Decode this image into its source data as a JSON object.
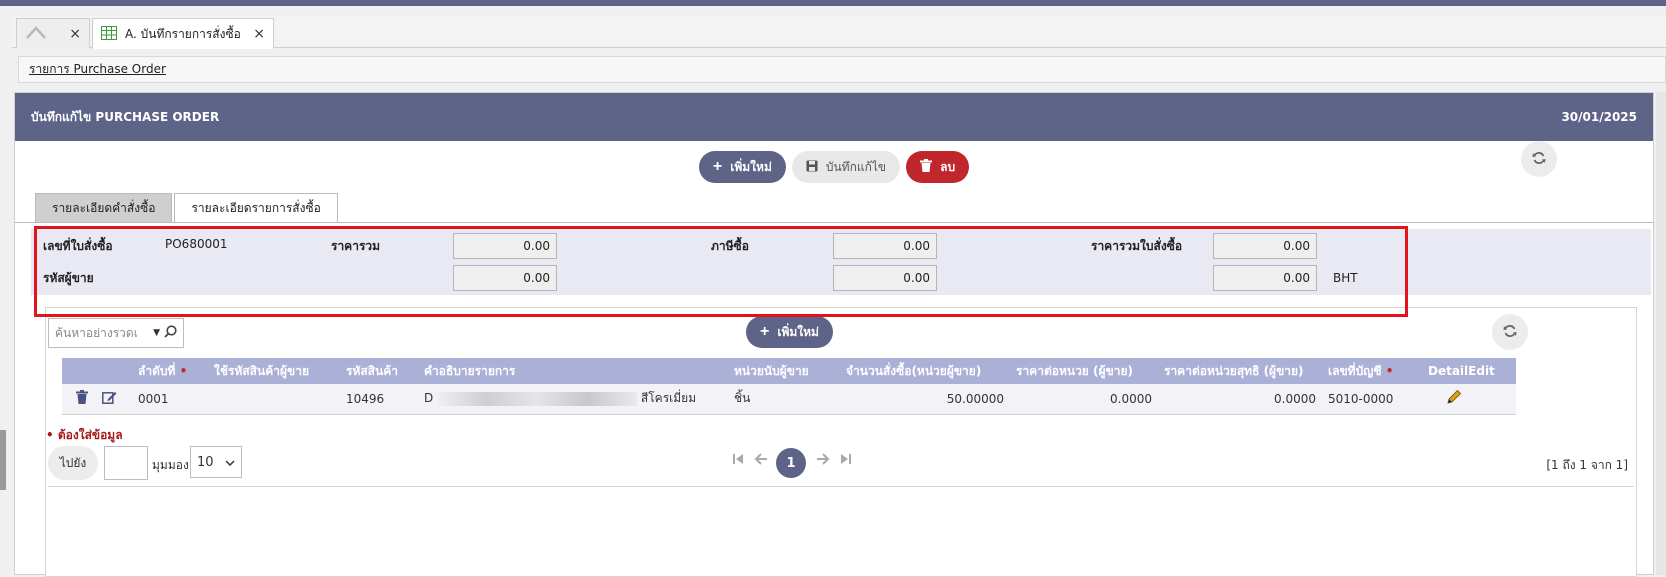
{
  "tabs": {
    "home_close": "×",
    "active_title": "A. บันทึกรายการสั่งซื้อ",
    "active_close": "×"
  },
  "breadcrumb": {
    "link": "รายการ Purchase Order"
  },
  "header": {
    "title": "บันทึกแก้ไข PURCHASE ORDER",
    "date": "30/01/2025"
  },
  "toolbar": {
    "add_label": "เพิ่มใหม่",
    "save_label": "บันทึกแก้ไข",
    "delete_label": "ลบ"
  },
  "subtabs": [
    {
      "label": "รายละเอียดคำสั่งซื้อ"
    },
    {
      "label": "รายละเอียดรายการสั่งซื้อ"
    }
  ],
  "summary": {
    "po_no_label": "เลขที่ใบสั่งซื้อ",
    "po_no": "PO680001",
    "vendor_code_label": "รหัสผู้ขาย",
    "total_label": "ราคารวม",
    "total": "0.00",
    "total_2": "0.00",
    "tax_label": "ภาษีซื้อ",
    "tax": "0.00",
    "tax_2": "0.00",
    "grand_label": "ราคารวมใบสั่งซื้อ",
    "grand": "0.00",
    "grand_2": "0.00",
    "currency": "BHT"
  },
  "grid": {
    "search_placeholder": "ค้นหาอย่างรวดเ",
    "add_label": "เพิ่มใหม่",
    "columns": {
      "seq": "ลำดับที่",
      "vendor_code": "ใช้รหัสสินค้าผู้ขาย",
      "product_code": "รหัสสินค้า",
      "description": "คำอธิบายรายการ",
      "unit": "หน่วยนับผู้ขาย",
      "qty": "จำนวนสั่งซื้อ(หน่วยผู้ขาย)",
      "unit_price": "ราคาต่อหนวย (ผู้ขาย)",
      "net_price": "ราคาต่อหน่วยสุทธิ (ผู้ขาย)",
      "account": "เลขที่บัญชี",
      "detail_edit": "DetailEdit"
    },
    "required_mark": "•",
    "rows": [
      {
        "seq": "0001",
        "vendor_code": "",
        "product_code": "10496",
        "desc_prefix": "D",
        "desc_suffix": "สีโครเมี่ยม",
        "unit": "ชิ้น",
        "qty": "50.00000",
        "unit_price": "0.0000",
        "net_price": "0.0000",
        "account": "5010-0000"
      }
    ],
    "required_note": "• ต้องใส่ข้อมูล"
  },
  "pager": {
    "go_label": "ไปยัง",
    "per_label": "มุมมอง",
    "per_value": "10",
    "current_page": "1",
    "range": "[1 ถึง 1 จาก 1]"
  }
}
